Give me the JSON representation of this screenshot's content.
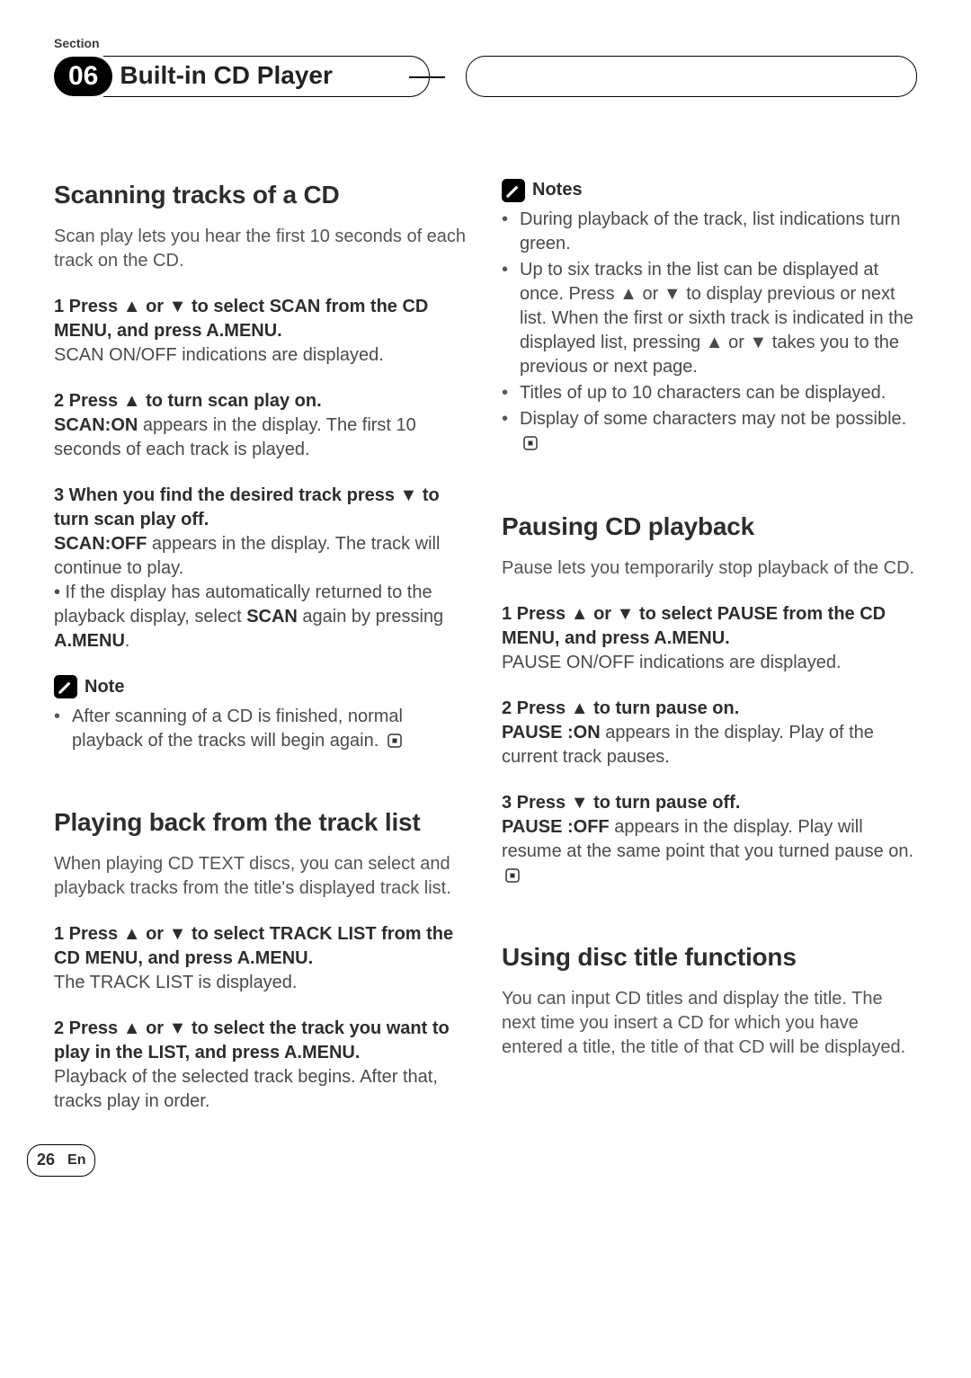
{
  "section": {
    "label": "Section",
    "number": "06",
    "chapterTitle": "Built-in CD Player"
  },
  "left": {
    "scanning": {
      "heading": "Scanning tracks of a CD",
      "intro": "Scan play lets you hear the first 10 seconds of each track on the CD.",
      "step1_lead": "1   Press ▲ or ▼ to select SCAN from the CD MENU, and press A.MENU.",
      "step1_body": "SCAN ON/OFF indications are displayed.",
      "step2_lead": "2   Press ▲ to turn scan play on.",
      "step2_body_pre": "SCAN:ON",
      "step2_body_rest": " appears in the display. The first 10 seconds of each track is played.",
      "step3_lead": "3   When you find the desired track press ▼ to turn scan play off.",
      "step3_body_pre": "SCAN:OFF",
      "step3_body_rest": " appears in the display. The track will continue to play.",
      "step3_extra_pre": "• If the display has automatically returned to the playback display, select ",
      "step3_extra_b1": "SCAN",
      "step3_extra_mid": " again by pressing ",
      "step3_extra_b2": "A.MENU",
      "step3_extra_post": ".",
      "noteLabel": "Note",
      "noteText": "After scanning of a CD is finished, normal playback of the tracks will begin again."
    },
    "tracklist": {
      "heading": "Playing back from the track list",
      "intro": "When playing CD TEXT discs, you can select and playback tracks from the title's displayed track list.",
      "step1_lead": "1   Press ▲ or ▼ to select TRACK LIST from the CD MENU, and press A.MENU.",
      "step1_body": "The TRACK LIST is displayed.",
      "step2_lead": "2   Press ▲ or ▼ to select the track you want to play in the LIST, and press A.MENU.",
      "step2_body": "Playback of the selected track begins. After that, tracks play in order."
    }
  },
  "right": {
    "notesLabel": "Notes",
    "notes": {
      "n1": "During playback of the track, list indications turn green.",
      "n2": "Up to six tracks in the list can be displayed at once. Press ▲ or ▼ to display previous or next list. When the first or sixth track is indicated in the displayed list, pressing ▲ or ▼ takes you to the previous or next page.",
      "n3": "Titles of up to 10 characters can be displayed.",
      "n4": "Display of some characters may not be possible."
    },
    "pausing": {
      "heading": "Pausing CD playback",
      "intro": "Pause lets you temporarily stop playback of the CD.",
      "step1_lead": "1   Press ▲ or ▼ to select PAUSE from the CD MENU, and press A.MENU.",
      "step1_body": "PAUSE ON/OFF indications are displayed.",
      "step2_lead": "2   Press ▲ to turn pause on.",
      "step2_pre": "PAUSE :ON",
      "step2_rest": " appears in the display. Play of the current track pauses.",
      "step3_lead": "3   Press ▼ to turn pause off.",
      "step3_pre": "PAUSE :OFF",
      "step3_rest": " appears in the display. Play will resume at the same point that you turned pause on."
    },
    "titles": {
      "heading": "Using disc title functions",
      "intro": "You can input CD titles and display the title. The next time you insert a CD for which you have entered a title, the title of that CD will be displayed."
    }
  },
  "footer": {
    "pageNumber": "26",
    "lang": "En"
  }
}
